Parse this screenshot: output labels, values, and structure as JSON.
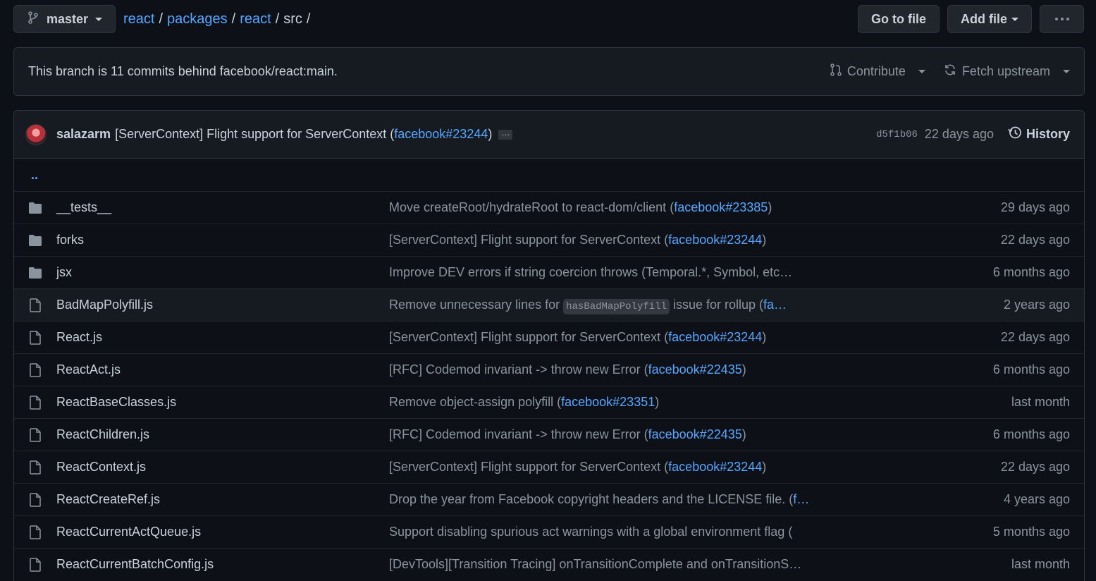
{
  "branch": {
    "name": "master"
  },
  "breadcrumb": {
    "links": [
      "react",
      "packages",
      "react"
    ],
    "current": "src",
    "sep": "/"
  },
  "actions": {
    "go_to_file": "Go to file",
    "add_file": "Add file"
  },
  "notice": {
    "text": "This branch is 11 commits behind facebook/react:main.",
    "contribute": "Contribute",
    "fetch": "Fetch upstream"
  },
  "commit": {
    "author": "salazarm",
    "message_pre": "[ServerContext] Flight support for ServerContext (",
    "message_link": "facebook#23244",
    "message_post": ")",
    "ellipsis": "…",
    "sha": "d5f1b06",
    "ago": "22 days ago",
    "history": "History"
  },
  "parent_dir": "..",
  "files": [
    {
      "type": "dir",
      "name": "__tests__",
      "pre": "Move createRoot/hydrateRoot to react-dom/client (",
      "link": "facebook#23385",
      "post": ")",
      "age": "29 days ago"
    },
    {
      "type": "dir",
      "name": "forks",
      "pre": "[ServerContext] Flight support for ServerContext (",
      "link": "facebook#23244",
      "post": ")",
      "age": "22 days ago"
    },
    {
      "type": "dir",
      "name": "jsx",
      "pre": "Improve DEV errors if string coercion throws (Temporal.*, Symbol, etc…",
      "link": "",
      "post": "",
      "age": "6 months ago"
    },
    {
      "type": "file",
      "name": "BadMapPolyfill.js",
      "pre": "Remove unnecessary lines for ",
      "code": "hasBadMapPolyfill",
      "mid": " issue for rollup (",
      "link": "fa…",
      "post": "",
      "age": "2 years ago"
    },
    {
      "type": "file",
      "name": "React.js",
      "pre": "[ServerContext] Flight support for ServerContext (",
      "link": "facebook#23244",
      "post": ")",
      "age": "22 days ago"
    },
    {
      "type": "file",
      "name": "ReactAct.js",
      "pre": "[RFC] Codemod invariant -> throw new Error (",
      "link": "facebook#22435",
      "post": ")",
      "age": "6 months ago"
    },
    {
      "type": "file",
      "name": "ReactBaseClasses.js",
      "pre": "Remove object-assign polyfill (",
      "link": "facebook#23351",
      "post": ")",
      "age": "last month"
    },
    {
      "type": "file",
      "name": "ReactChildren.js",
      "pre": "[RFC] Codemod invariant -> throw new Error (",
      "link": "facebook#22435",
      "post": ")",
      "age": "6 months ago"
    },
    {
      "type": "file",
      "name": "ReactContext.js",
      "pre": "[ServerContext] Flight support for ServerContext (",
      "link": "facebook#23244",
      "post": ")",
      "age": "22 days ago"
    },
    {
      "type": "file",
      "name": "ReactCreateRef.js",
      "pre": "Drop the year from Facebook copyright headers and the LICENSE file. (",
      "link": "f…",
      "post": "",
      "age": "4 years ago"
    },
    {
      "type": "file",
      "name": "ReactCurrentActQueue.js",
      "pre": "Support disabling spurious act warnings with a global environment flag (",
      "link": "",
      "post": "",
      "age": "5 months ago"
    },
    {
      "type": "file",
      "name": "ReactCurrentBatchConfig.js",
      "pre": "[DevTools][Transition Tracing] onTransitionComplete and onTransitionS…",
      "link": "",
      "post": "",
      "age": "last month"
    }
  ]
}
